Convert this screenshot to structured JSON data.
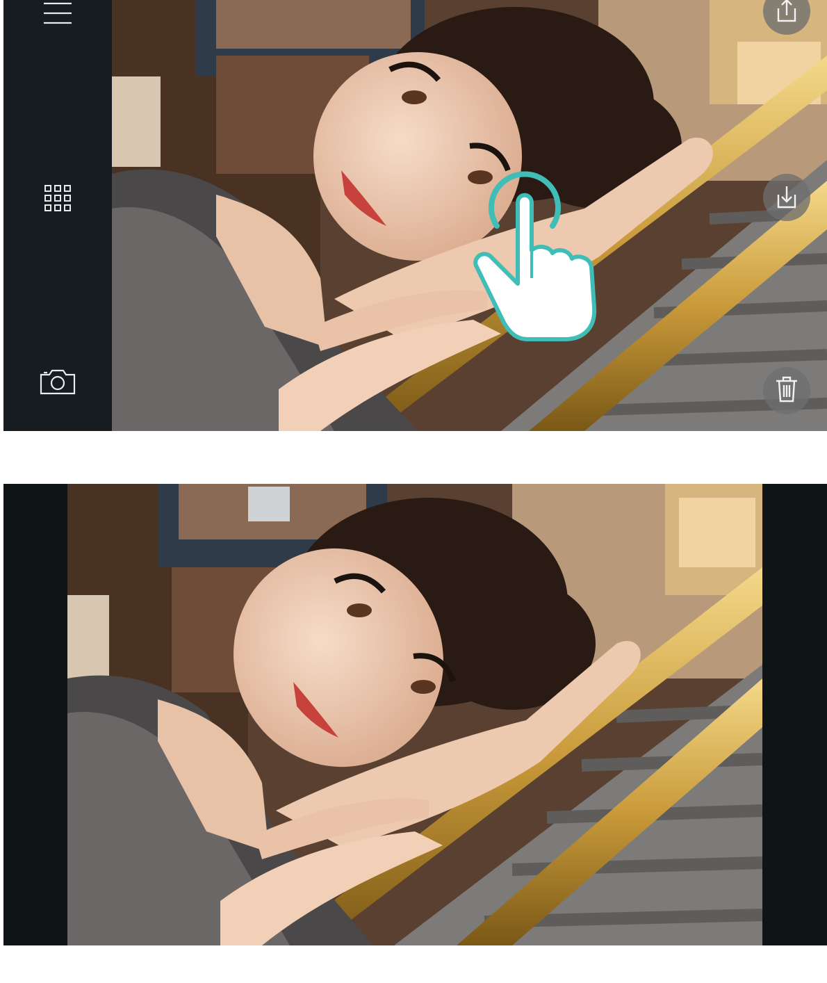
{
  "theme": {
    "bg_dark": "#0f1416",
    "sidebar_bg": "#171c20",
    "tap_accent": "#3fbdb6",
    "button_bg": "#6e6e6e"
  },
  "top_screen": {
    "sidebar": {
      "items": [
        {
          "icon": "menu-icon"
        },
        {
          "icon": "grid-icon"
        },
        {
          "icon": "camera-icon"
        }
      ]
    },
    "actions": [
      {
        "icon": "share-icon"
      },
      {
        "icon": "share-icon"
      },
      {
        "icon": "trash-icon"
      }
    ],
    "gesture_hint": {
      "icon": "tap-hand-icon",
      "gesture": "tap"
    }
  },
  "bottom_screen": {
    "photo": {
      "mode": "full-view"
    }
  }
}
